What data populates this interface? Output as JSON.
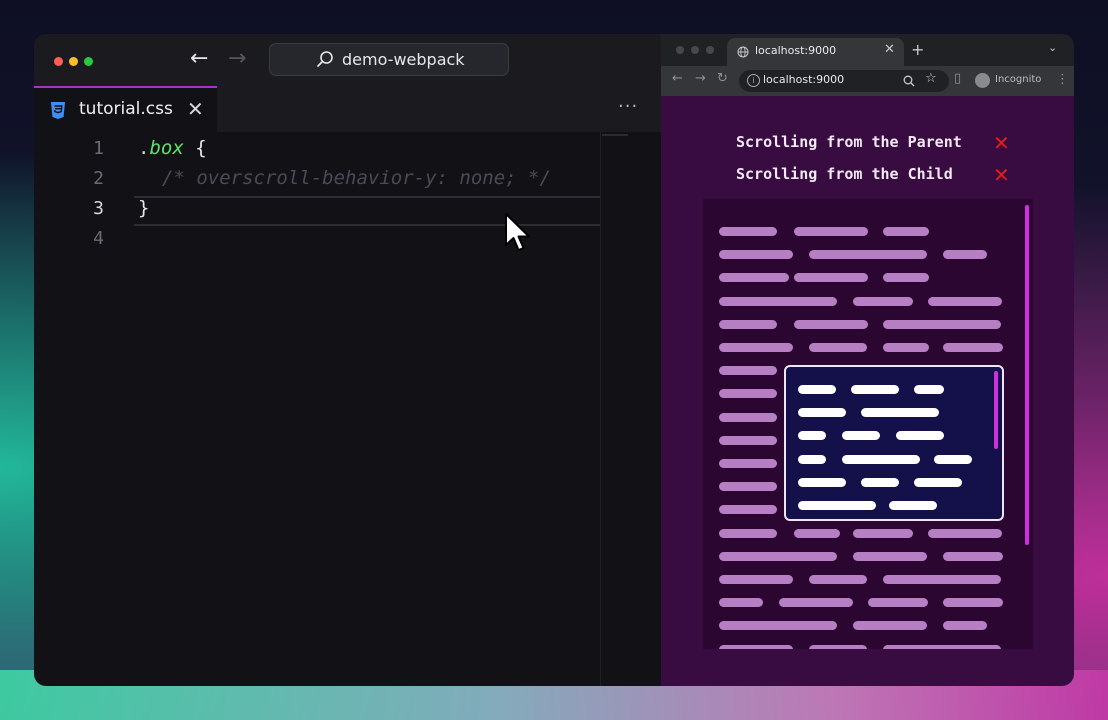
{
  "editor": {
    "search_text": "demo-webpack",
    "tab": {
      "file_name": "tutorial.css",
      "close_symbol": "✕"
    },
    "more_symbol": "···",
    "code_lines": [
      {
        "number": "1",
        "text": ".box {"
      },
      {
        "number": "2",
        "text": "/* overscroll-behavior-y: none; */"
      },
      {
        "number": "3",
        "text": "}"
      },
      {
        "number": "4",
        "text": ""
      }
    ],
    "icons": [
      "back-arrow-icon",
      "forward-arrow-icon",
      "search-icon",
      "css-file-icon",
      "close-icon",
      "more-icon"
    ]
  },
  "browser": {
    "tab_title": "localhost:9000",
    "url": "localhost:9000",
    "profile_label": "Incognito",
    "page": {
      "status_items": [
        {
          "label": "Scrolling from the Parent",
          "state": "✕",
          "color": "#e01c1c"
        },
        {
          "label": "Scrolling from the Child",
          "state": "✕",
          "color": "#e01c1c"
        }
      ]
    }
  },
  "colors": {
    "editor_bg": "#111116",
    "tab_accent": "#a335c8",
    "page_bg": "#380c41",
    "parent_bar": "#b67fc4",
    "child_bg": "#14114a",
    "scrollbar": "#d12ee0",
    "selector_green": "#5ee36b"
  }
}
